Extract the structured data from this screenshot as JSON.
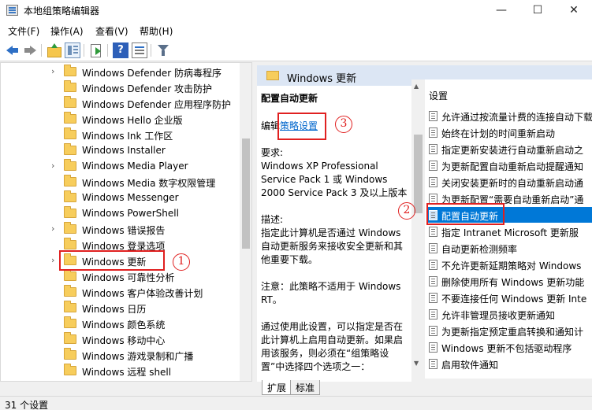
{
  "window": {
    "title": "本地组策略编辑器",
    "min": "—",
    "max": "☐",
    "close": "✕"
  },
  "menu": [
    "文件(F)",
    "操作(A)",
    "查看(V)",
    "帮助(H)"
  ],
  "tree": {
    "items": [
      {
        "label": "Windows Defender 防病毒程序",
        "expandable": true
      },
      {
        "label": "Windows Defender 攻击防护",
        "expandable": false
      },
      {
        "label": "Windows Defender 应用程序防护",
        "expandable": false
      },
      {
        "label": "Windows Hello 企业版",
        "expandable": false
      },
      {
        "label": "Windows Ink 工作区",
        "expandable": false
      },
      {
        "label": "Windows Installer",
        "expandable": false
      },
      {
        "label": "Windows Media Player",
        "expandable": true
      },
      {
        "label": "Windows Media 数字权限管理",
        "expandable": false
      },
      {
        "label": "Windows Messenger",
        "expandable": false
      },
      {
        "label": "Windows PowerShell",
        "expandable": false
      },
      {
        "label": "Windows 错误报告",
        "expandable": true
      },
      {
        "label": "Windows 登录选项",
        "expandable": false
      },
      {
        "label": "Windows 更新",
        "expandable": true
      },
      {
        "label": "Windows 可靠性分析",
        "expandable": false
      },
      {
        "label": "Windows 客户体验改善计划",
        "expandable": false
      },
      {
        "label": "Windows 日历",
        "expandable": false
      },
      {
        "label": "Windows 颜色系统",
        "expandable": false
      },
      {
        "label": "Windows 移动中心",
        "expandable": false
      },
      {
        "label": "Windows 游戏录制和广播",
        "expandable": false
      },
      {
        "label": "Windows 远程 shell",
        "expandable": false
      }
    ]
  },
  "banner": {
    "title": "Windows 更新"
  },
  "description": {
    "heading": "配置自动更新",
    "edit_prefix": "编辑",
    "edit_link": "策略设置",
    "requirements_label": "要求:",
    "requirements": "Windows XP Professional Service Pack 1 或 Windows 2000 Service Pack 3 及以上版本",
    "desc_label": "描述:",
    "desc_text": "指定此计算机是否通过 Windows 自动更新服务来接收安全更新和其他重要下载。",
    "note": "注意：此策略不适用于 Windows RT。",
    "more": "通过使用此设置，可以指定是否在此计算机上启用自动更新。如果启用该服务，则必须在“组策略设置”中选择四个选项之一："
  },
  "settings": {
    "header": "设置",
    "items": [
      "允许通过按流量计费的连接自动下载",
      "始终在计划的时间重新启动",
      "指定更新安装进行自动重新启动之",
      "为更新配置自动重新启动提醒通知",
      "关闭安装更新时的自动重新启动通",
      "为更新配置“需要自动重新启动”通",
      "配置自动更新",
      "指定 Intranet Microsoft 更新服",
      "自动更新检测频率",
      "不允许更新延期策略对 Windows",
      "删除使用所有 Windows 更新功能",
      "不要连接任何 Windows 更新 Inte",
      "允许非管理员接收更新通知",
      "为更新指定预定重启转换和通知计",
      "Windows 更新不包括驱动程序",
      "启用软件通知"
    ],
    "selected_index": 6
  },
  "tabs": [
    "扩展",
    "标准"
  ],
  "status": "31 个设置",
  "annotations": [
    "1",
    "2",
    "3"
  ],
  "colors": {
    "selection": "#0078d7",
    "annotation": "#e02020",
    "link": "#0066cc",
    "banner": "#dce6f4"
  }
}
